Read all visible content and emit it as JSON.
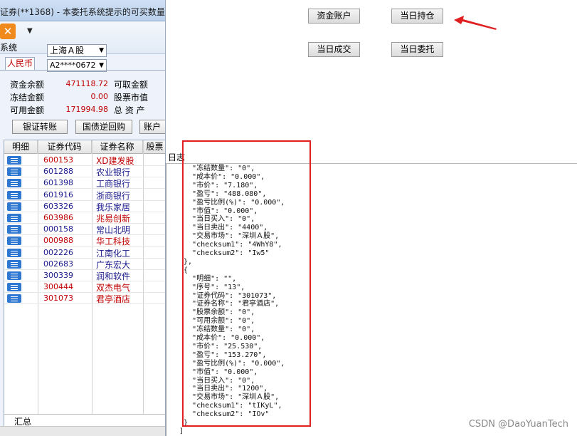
{
  "window": {
    "title": "证券(**1368) - 本委托系统提示的可买数量",
    "toolbar_label": "系统",
    "market": "上海Ａ股",
    "account": "A2****0672",
    "currency_tab": "人民币"
  },
  "funds": [
    {
      "label": "资金余额",
      "value": "471118.72",
      "label2": "可取金额"
    },
    {
      "label": "冻结金额",
      "value": "0.00",
      "label2": "股票市值"
    },
    {
      "label": "可用金额",
      "value": "171994.98",
      "label2": "总 资 产"
    }
  ],
  "buttons": {
    "transfer": "银证转账",
    "repo": "国债逆回购",
    "account": "账户"
  },
  "grid": {
    "headers": [
      "明细",
      "证券代码",
      "证券名称",
      "股票"
    ],
    "rows": [
      {
        "code": "600153",
        "name": "XD建发股",
        "red": true
      },
      {
        "code": "601288",
        "name": "农业银行",
        "red": false
      },
      {
        "code": "601398",
        "name": "工商银行",
        "red": false
      },
      {
        "code": "601916",
        "name": "浙商银行",
        "red": false
      },
      {
        "code": "603326",
        "name": "我乐家居",
        "red": false
      },
      {
        "code": "603986",
        "name": "兆易创新",
        "red": true
      },
      {
        "code": "000158",
        "name": "常山北明",
        "red": false
      },
      {
        "code": "000988",
        "name": "华工科技",
        "red": true
      },
      {
        "code": "002226",
        "name": "江南化工",
        "red": false
      },
      {
        "code": "002683",
        "name": "广东宏大",
        "red": false
      },
      {
        "code": "300339",
        "name": "润和软件",
        "red": false
      },
      {
        "code": "300444",
        "name": "双杰电气",
        "red": true
      },
      {
        "code": "301073",
        "name": "君亭酒店",
        "red": true
      }
    ],
    "total_label": "汇总"
  },
  "right_panel": {
    "fund_account": "资金账户",
    "today_position": "当日持仓",
    "today_deals": "当日成交",
    "today_orders": "当日委托",
    "log_label": "日志"
  },
  "log_lines": [
    "   \"冻结数量\": \"0\",",
    "   \"成本价\": \"0.000\",",
    "   \"市价\": \"7.180\",",
    "   \"盈亏\": \"488.080\",",
    "   \"盈亏比例(%)\": \"0.000\",",
    "   \"市值\": \"0.000\",",
    "   \"当日买入\": \"0\",",
    "   \"当日卖出\": \"4400\",",
    "   \"交易市场\": \"深圳Ａ股\",",
    "   \"checksum1\": \"4WhY8\",",
    "   \"checksum2\": \"Iw5\"",
    " },",
    " {",
    "   \"明细\": \"\",",
    "   \"序号\": \"13\",",
    "   \"证券代码\": \"301073\",",
    "   \"证券名称\": \"君亭酒店\",",
    "   \"股票余额\": \"0\",",
    "   \"可用余额\": \"0\",",
    "   \"冻结数量\": \"0\",",
    "   \"成本价\": \"0.000\",",
    "   \"市价\": \"25.530\",",
    "   \"盈亏\": \"153.270\",",
    "   \"盈亏比例(%)\": \"0.000\",",
    "   \"市值\": \"0.000\",",
    "   \"当日买入\": \"0\",",
    "   \"当日卖出\": \"1200\",",
    "   \"交易市场\": \"深圳Ａ股\",",
    "   \"checksum1\": \"tIKyL\",",
    "   \"checksum2\": \"IOv\"",
    " }",
    "]"
  ],
  "watermark": "CSDN @DaoYuanTech",
  "colors": {
    "stock_red": "#c00000",
    "stock_blue": "#1a1a8c",
    "highlight_box": "#e02020"
  }
}
